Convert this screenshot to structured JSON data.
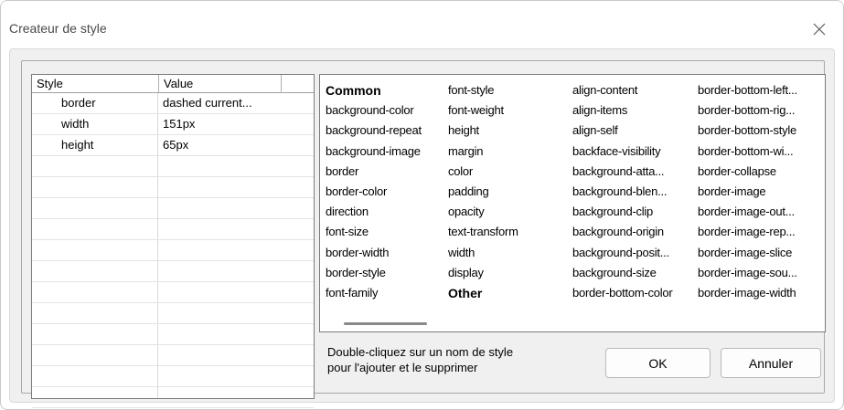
{
  "window": {
    "title": "Createur de style"
  },
  "property_list": {
    "headers": [
      "Style",
      "Value"
    ],
    "rows": [
      {
        "style": "border",
        "value": "dashed current..."
      },
      {
        "style": "width",
        "value": "151px"
      },
      {
        "style": "height",
        "value": "65px"
      }
    ]
  },
  "style_grid": {
    "columns": [
      [
        {
          "label": "Common",
          "bold": true
        },
        {
          "label": "background-color"
        },
        {
          "label": "background-repeat"
        },
        {
          "label": "background-image"
        },
        {
          "label": "border"
        },
        {
          "label": "border-color"
        },
        {
          "label": "direction"
        },
        {
          "label": "font-size"
        },
        {
          "label": "border-width"
        },
        {
          "label": "border-style"
        },
        {
          "label": "font-family"
        }
      ],
      [
        {
          "label": "font-style"
        },
        {
          "label": "font-weight"
        },
        {
          "label": "height"
        },
        {
          "label": "margin"
        },
        {
          "label": "color"
        },
        {
          "label": "padding"
        },
        {
          "label": "opacity"
        },
        {
          "label": "text-transform"
        },
        {
          "label": "width"
        },
        {
          "label": "display"
        },
        {
          "label": "Other",
          "bold": true
        }
      ],
      [
        {
          "label": "align-content"
        },
        {
          "label": "align-items"
        },
        {
          "label": "align-self"
        },
        {
          "label": "backface-visibility"
        },
        {
          "label": "background-atta..."
        },
        {
          "label": "background-blen..."
        },
        {
          "label": "background-clip"
        },
        {
          "label": "background-origin"
        },
        {
          "label": "background-posit..."
        },
        {
          "label": "background-size"
        },
        {
          "label": "border-bottom-color"
        }
      ],
      [
        {
          "label": "border-bottom-left..."
        },
        {
          "label": "border-bottom-rig..."
        },
        {
          "label": "border-bottom-style"
        },
        {
          "label": "border-bottom-wi..."
        },
        {
          "label": "border-collapse"
        },
        {
          "label": "border-image"
        },
        {
          "label": "border-image-out..."
        },
        {
          "label": "border-image-rep..."
        },
        {
          "label": "border-image-slice"
        },
        {
          "label": "border-image-sou..."
        },
        {
          "label": "border-image-width"
        }
      ]
    ]
  },
  "hint": {
    "line1": "Double-cliquez sur un nom de style",
    "line2": "pour l'ajouter et le supprimer"
  },
  "buttons": {
    "ok": "OK",
    "cancel": "Annuler"
  },
  "icons": {
    "close": "close-icon"
  }
}
